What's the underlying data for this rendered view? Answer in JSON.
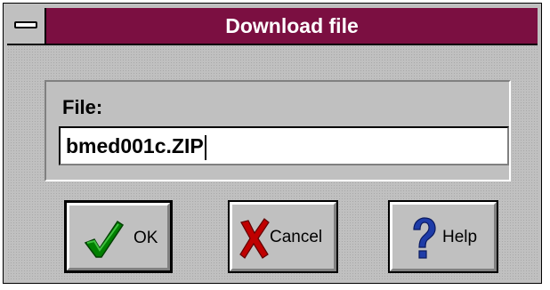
{
  "window": {
    "title": "Download file"
  },
  "form": {
    "file_label": "File:",
    "file_value": "bmed001c.ZIP"
  },
  "buttons": {
    "ok_label": "OK",
    "cancel_label": "Cancel",
    "help_label": "Help"
  },
  "icons": {
    "system_menu": "system-menu-icon",
    "ok": "checkmark-icon",
    "cancel": "x-mark-icon",
    "help": "question-mark-icon"
  },
  "colors": {
    "title_bar": "#7b0f41",
    "face": "#c0c0c0",
    "check_green": "#008000",
    "cross_red": "#c00000",
    "question_blue": "#1e3ca8"
  }
}
